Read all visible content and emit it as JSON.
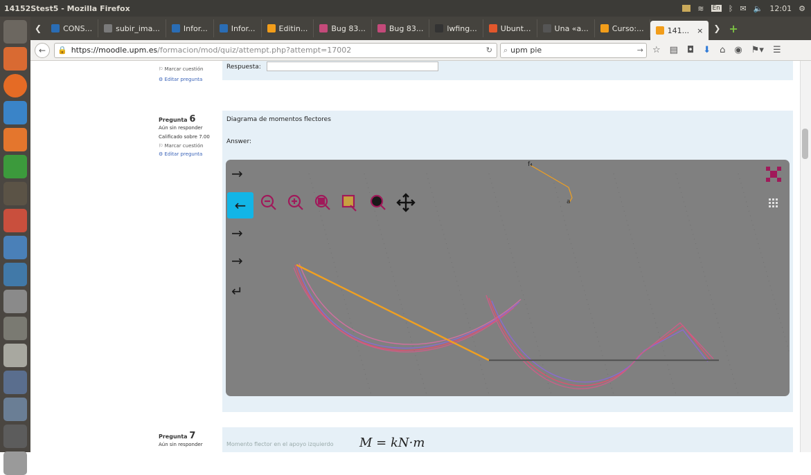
{
  "os": {
    "window_title": "14152Stest5 - Mozilla Firefox",
    "clock": "12:01",
    "volume": "4"
  },
  "tabs": [
    {
      "label": "CONS...",
      "color": "#2a6db5"
    },
    {
      "label": "subir_ima...",
      "color": "#7a7a7a"
    },
    {
      "label": "Infor...",
      "color": "#2a6db5"
    },
    {
      "label": "Infor...",
      "color": "#2a6db5"
    },
    {
      "label": "Editin...",
      "color": "#f29d1a"
    },
    {
      "label": "Bug 83...",
      "color": "#c44a7a"
    },
    {
      "label": "Bug 83...",
      "color": "#c44a7a"
    },
    {
      "label": "lwfing...",
      "color": "#333"
    },
    {
      "label": "Ubunt...",
      "color": "#e2572c"
    },
    {
      "label": "Una «a...",
      "color": "#555"
    },
    {
      "label": "Curso:...",
      "color": "#f29d1a"
    },
    {
      "label": "141...",
      "color": "#f29d1a"
    }
  ],
  "nav": {
    "url_host": "https://moodle.upm.es",
    "url_path": "/formacion/mod/quiz/attempt.php?attempt=17002",
    "search_value": "upm pie"
  },
  "prev_question": {
    "answer_label": "Respuesta:",
    "flag_label": "Marcar cuestión",
    "edit_label": "Editar pregunta"
  },
  "question6": {
    "prefix": "Pregunta",
    "number": "6",
    "status": "Aún sin responder",
    "grade": "Calificado sobre 7.00",
    "flag_label": "Marcar cuestión",
    "edit_label": "Editar pregunta",
    "text": "Diagrama de momentos flectores",
    "answer_label": "Answer:"
  },
  "applet": {
    "arrows": [
      "→",
      "←",
      "→",
      "→",
      "↵"
    ],
    "zoom_tools": [
      "zoom-out",
      "zoom-in",
      "zoom-fit",
      "zoom-select",
      "zoom-home",
      "move"
    ],
    "point_labels": [
      "f₄",
      "a"
    ],
    "colors": {
      "background": "#808080",
      "active_button": "#12b5e6",
      "tool": "#a0195a",
      "orange_line": "#f0a020",
      "curve_red": "#e0506e",
      "curve_purple": "#8a6ad0"
    }
  },
  "question7": {
    "prefix": "Pregunta",
    "number": "7",
    "status": "Aún sin responder",
    "text": "Momento flector en el apoyo izquierdo",
    "math": "M = kN·m"
  }
}
